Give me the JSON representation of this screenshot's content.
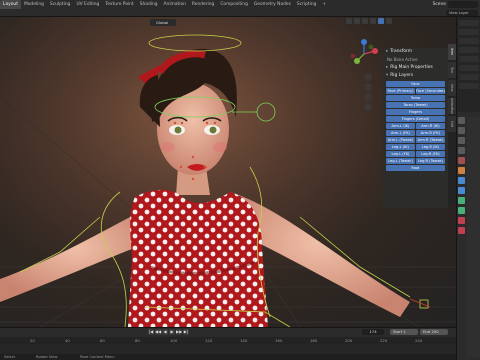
{
  "workspace_tabs": [
    "Layout",
    "Modeling",
    "Sculpting",
    "UV Editing",
    "Texture Paint",
    "Shading",
    "Animation",
    "Rendering",
    "Compositing",
    "Geometry Nodes",
    "Scripting",
    "+"
  ],
  "active_workspace": "Layout",
  "scene_label": "Scene",
  "view_layer_label": "View Layer",
  "viewport": {
    "mode_label": "Global",
    "pose_options_label": "Pose Options"
  },
  "npanel": {
    "transform_header": "Transform",
    "no_bone_label": "No Bone Active",
    "rig_props_header": "Rig Main Properties",
    "rig_layers_header": "Rig Layers",
    "layer_rows": [
      [
        "Face"
      ],
      [
        "Face (Primary)",
        "Face (Secondary)"
      ],
      [
        "Torso"
      ],
      [
        "Torso (Tweak)"
      ],
      [
        "Fingers"
      ],
      [
        "Fingers (Detail)"
      ],
      [
        "Arm.L (IK)",
        "Arm.R (IK)"
      ],
      [
        "Arm.L (FK)",
        "Arm.R (FK)"
      ],
      [
        "Arm.L (Tweak)",
        "Arm.R (Tweak)"
      ],
      [
        "Leg.L (IK)",
        "Leg.R (IK)"
      ],
      [
        "Leg.L (FK)",
        "Leg.R (FK)"
      ],
      [
        "Leg.L (Tweak)",
        "Leg.R (Tweak)"
      ],
      [
        "Root"
      ]
    ],
    "tabs": [
      "Item",
      "Tool",
      "View",
      "Animation",
      "Edit"
    ]
  },
  "timeline": {
    "current_frame": "174",
    "start_label": "Start",
    "start_value": "1",
    "end_label": "End",
    "end_value": "250",
    "ruler_ticks": [
      "20",
      "40",
      "60",
      "80",
      "100",
      "120",
      "140",
      "160",
      "180",
      "200",
      "220",
      "240"
    ],
    "playback_buttons": [
      "|◀",
      "◀◀",
      "◀",
      "▶",
      "▶▶",
      "▶|"
    ]
  },
  "statusbar": {
    "select_label": "Select",
    "rotate_label": "Rotate View",
    "context_label": "Pose Context Menu"
  },
  "colors": {
    "accent": "#4772b3",
    "rig_widget": "#c8d24a",
    "dress_red": "#b0181c",
    "polka_dot": "#f4eeee",
    "skin": "#e3a388",
    "hair": "#2a1a14"
  },
  "icons": [
    "gizmo-axis-icon",
    "zoom-icon",
    "hand-pan-icon",
    "camera-icon",
    "perspective-icon"
  ]
}
